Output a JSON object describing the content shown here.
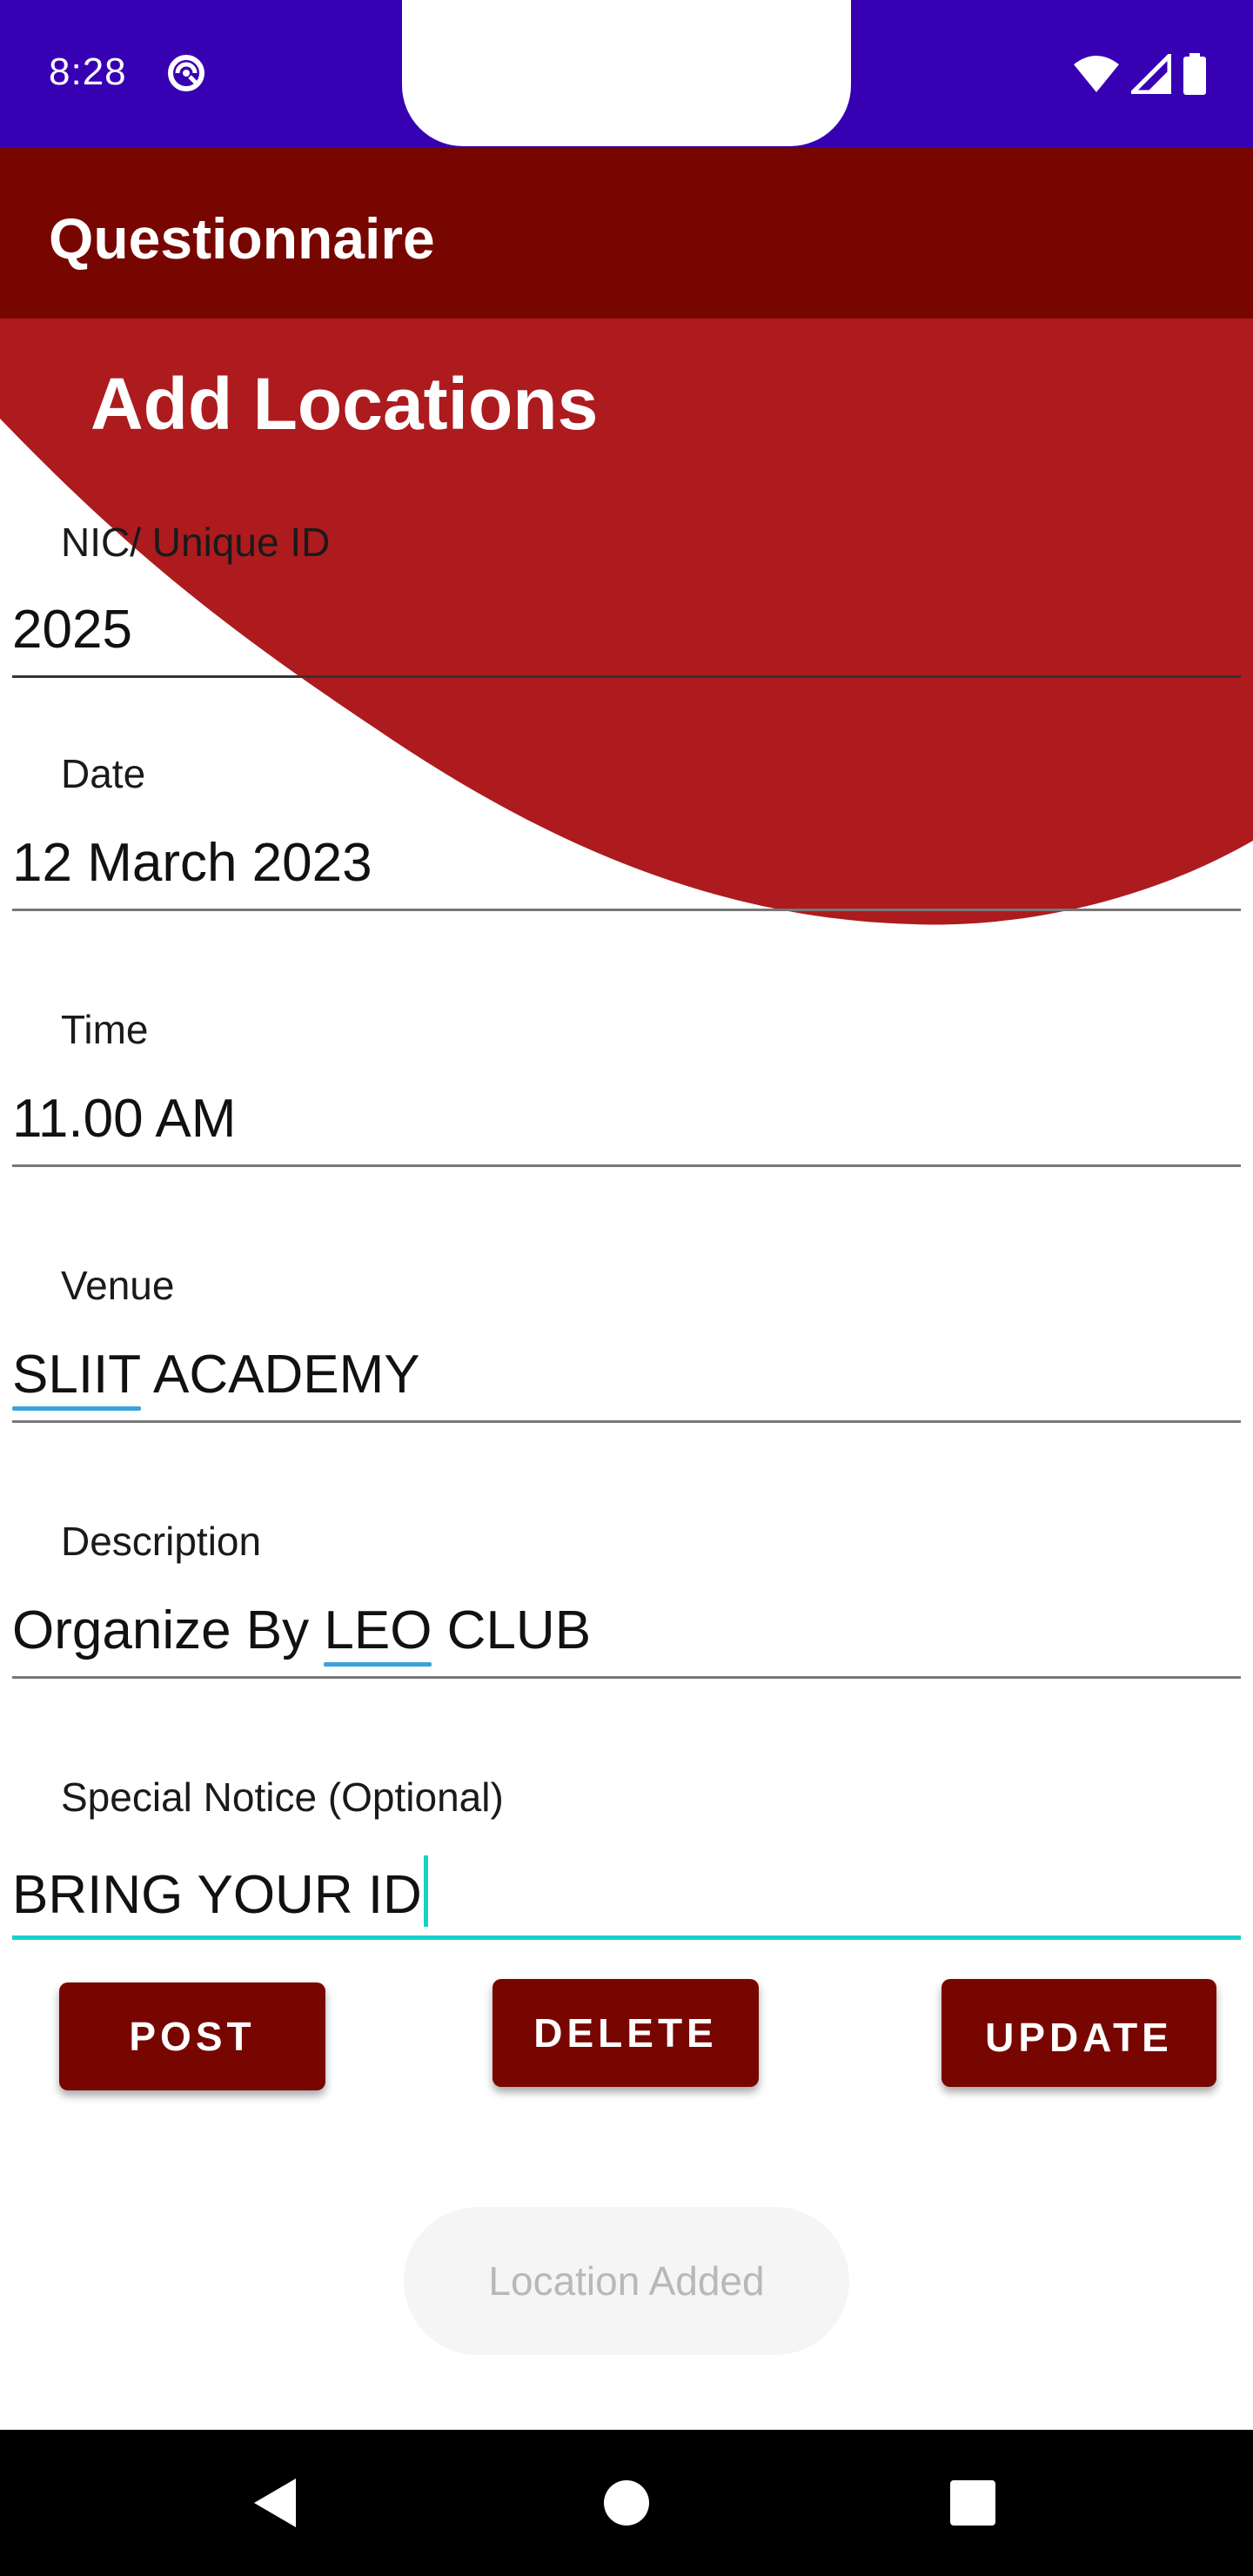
{
  "status_bar": {
    "time": "8:28",
    "icons": [
      "wifi-icon",
      "signal-icon",
      "battery-icon"
    ]
  },
  "app_bar": {
    "title": "Questionnaire"
  },
  "page": {
    "title": "Add Locations"
  },
  "form": {
    "nic": {
      "label": "NIC/ Unique ID",
      "value": "2025"
    },
    "date": {
      "label": "Date",
      "value": "12 March 2023"
    },
    "time": {
      "label": "Time",
      "value": "11.00 AM"
    },
    "venue": {
      "label": "Venue",
      "value_part1": "SLIIT",
      "value_part2": " ACADEMY"
    },
    "description": {
      "label": "Description",
      "value_part1": "Organize By ",
      "value_part2": "LEO",
      "value_part3": " CLUB"
    },
    "notice": {
      "label": "Special Notice (Optional)",
      "value": "BRING YOUR ID"
    }
  },
  "buttons": {
    "post": "POST",
    "delete": "DELETE",
    "update": "UPDATE"
  },
  "toast": {
    "message": "Location Added"
  },
  "colors": {
    "status_bar": "#3700b3",
    "app_bar": "#780600",
    "wave": "#ad1b1e",
    "button": "#780600",
    "focus": "#17d1c6",
    "spellcheck": "#3aa2dd"
  }
}
